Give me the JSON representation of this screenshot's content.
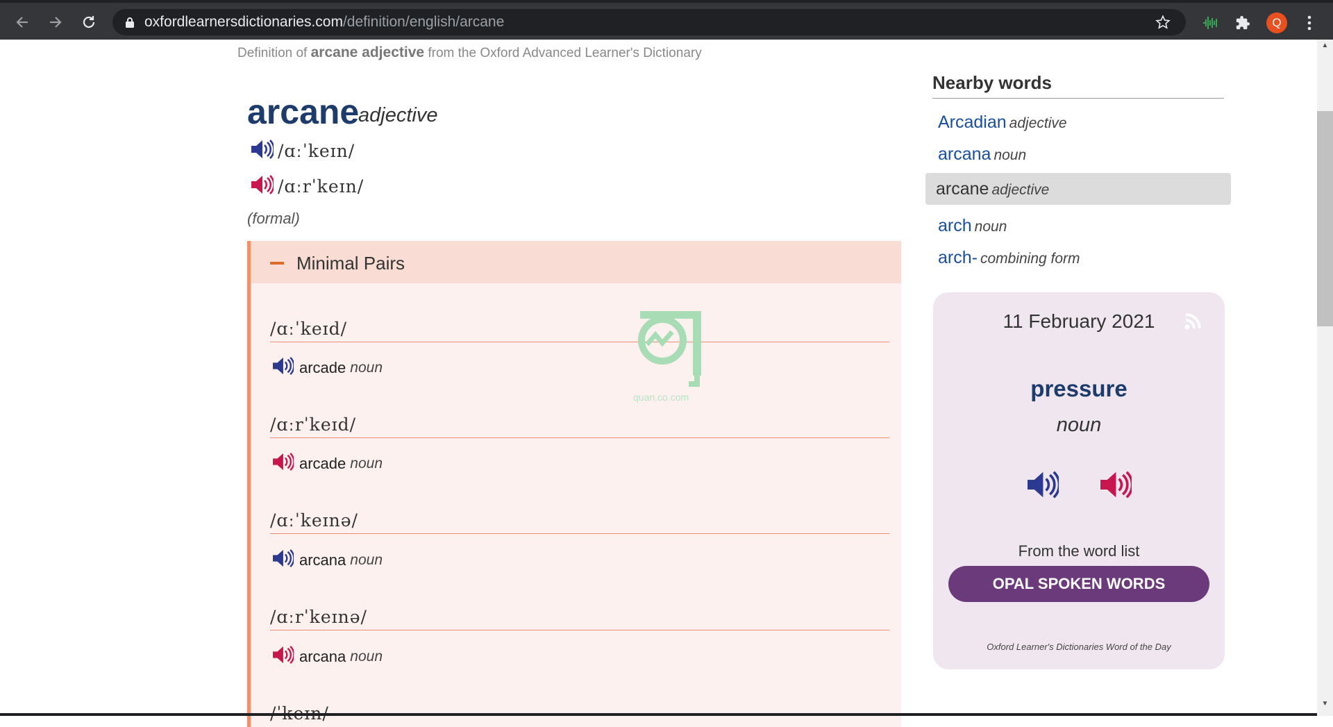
{
  "browser": {
    "url_host": "oxfordlearnersdictionaries.com",
    "url_path": "/definition/english/arcane",
    "profile_initial": "Q"
  },
  "breadcrumb": {
    "prefix": "Definition of",
    "term": "arcane adjective",
    "suffix": "from the Oxford Advanced Learner's Dictionary"
  },
  "entry": {
    "headword": "arcane",
    "pos": "adjective",
    "pron_uk": "/ɑːˈkeɪn/",
    "pron_us": "/ɑːrˈkeɪn/",
    "register": "(formal)"
  },
  "minimal_pairs": {
    "title": "Minimal Pairs",
    "items": [
      {
        "ipa": "/ɑːˈkeɪd/",
        "word": "arcade",
        "pos": "noun"
      },
      {
        "ipa": "/ɑːrˈkeɪd/",
        "word": "arcade",
        "pos": "noun"
      },
      {
        "ipa": "/ɑːˈkeɪnə/",
        "word": "arcana",
        "pos": "noun"
      },
      {
        "ipa": "/ɑːrˈkeɪnə/",
        "word": "arcana",
        "pos": "noun"
      }
    ],
    "partial_next": "/ˈkeɪn/"
  },
  "nearby": {
    "title": "Nearby words",
    "items": [
      {
        "word": "Arcadian",
        "pos": "adjective"
      },
      {
        "word": "arcana",
        "pos": "noun"
      },
      {
        "word": "arcane",
        "pos": "adjective"
      },
      {
        "word": "arch",
        "pos": "noun"
      },
      {
        "word": "arch-",
        "pos": "combining form"
      }
    ]
  },
  "wotd": {
    "date": "11 February 2021",
    "word": "pressure",
    "pos": "noun",
    "from_label": "From the word list",
    "list_button": "OPAL SPOKEN WORDS",
    "footer": "Oxford Learner's Dictionaries Word of the Day"
  },
  "watermark": {
    "text": "quan.co.com"
  },
  "colors": {
    "uk_audio": "#2b3990",
    "us_audio": "#c8174f",
    "accent": "#6b3a7b"
  }
}
